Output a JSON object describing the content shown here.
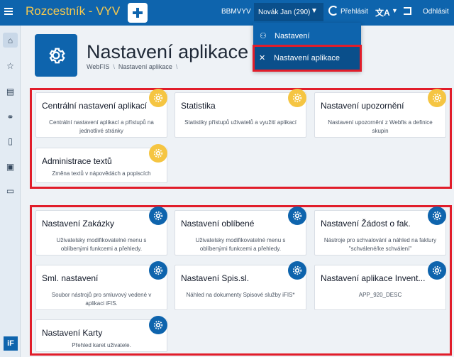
{
  "topbar": {
    "app_title": "Rozcestník - VYV",
    "environment": "BBMVYV",
    "user": "Novák Jan (290)",
    "switch_label": "Přehlásit",
    "logout_label": "Odhlásit"
  },
  "dropdown": {
    "items": [
      {
        "label": "Nastavení",
        "icon": "user-icon"
      },
      {
        "label": "Nastavení aplikace",
        "icon": "tools-icon"
      }
    ]
  },
  "header": {
    "title": "Nastavení aplikace",
    "breadcrumb": [
      "WebFIS",
      "Nastavení aplikace"
    ]
  },
  "sidebar": {
    "items": [
      "home-icon",
      "star-icon",
      "document-icon",
      "handshake-icon",
      "file-icon",
      "notebook-icon",
      "card-icon"
    ],
    "logo": "iF"
  },
  "group1": [
    {
      "title": "Centrální nastavení aplikací",
      "desc": "Centrální nastavení aplikací a přístupů na jednotlivé stránky"
    },
    {
      "title": "Statistika",
      "desc": "Statistiky přístupů uživatelů a využití aplikací"
    },
    {
      "title": "Nastavení upozornění",
      "desc": "Nastavení upozornění z Webfis a definice skupin"
    },
    {
      "title": "Administrace textů",
      "desc": "Změna textů v nápovědách a popiscích"
    }
  ],
  "group2": [
    {
      "title": "Nastavení Zakázky",
      "desc": "Uživatelsky modifikovatelné menu s oblíbenými funkcemi a přehledy."
    },
    {
      "title": "Nastavení oblíbené",
      "desc": "Uživatelsky modifikovatelné menu s oblíbenými funkcemi a přehledy."
    },
    {
      "title": "Nastavení Žádost o fak.",
      "desc": "Nástroje pro schvalování a náhled na faktury \"schválené/ke schválení\""
    },
    {
      "title": "Sml. nastavení",
      "desc": "Soubor nástrojů pro smluvový vedené v aplikaci iFIS."
    },
    {
      "title": "Nastavení Spis.sl.",
      "desc": "Náhled na dokumenty Spisové služby iFIS*"
    },
    {
      "title": "Nastavení aplikace Invent...",
      "desc": "APP_920_DESC"
    },
    {
      "title": "Nastavení Karty",
      "desc": "Přehled karet uživatele."
    }
  ],
  "colors": {
    "primary": "#0e64ad",
    "accent": "#f6c94e",
    "highlight": "#e11d2a"
  }
}
